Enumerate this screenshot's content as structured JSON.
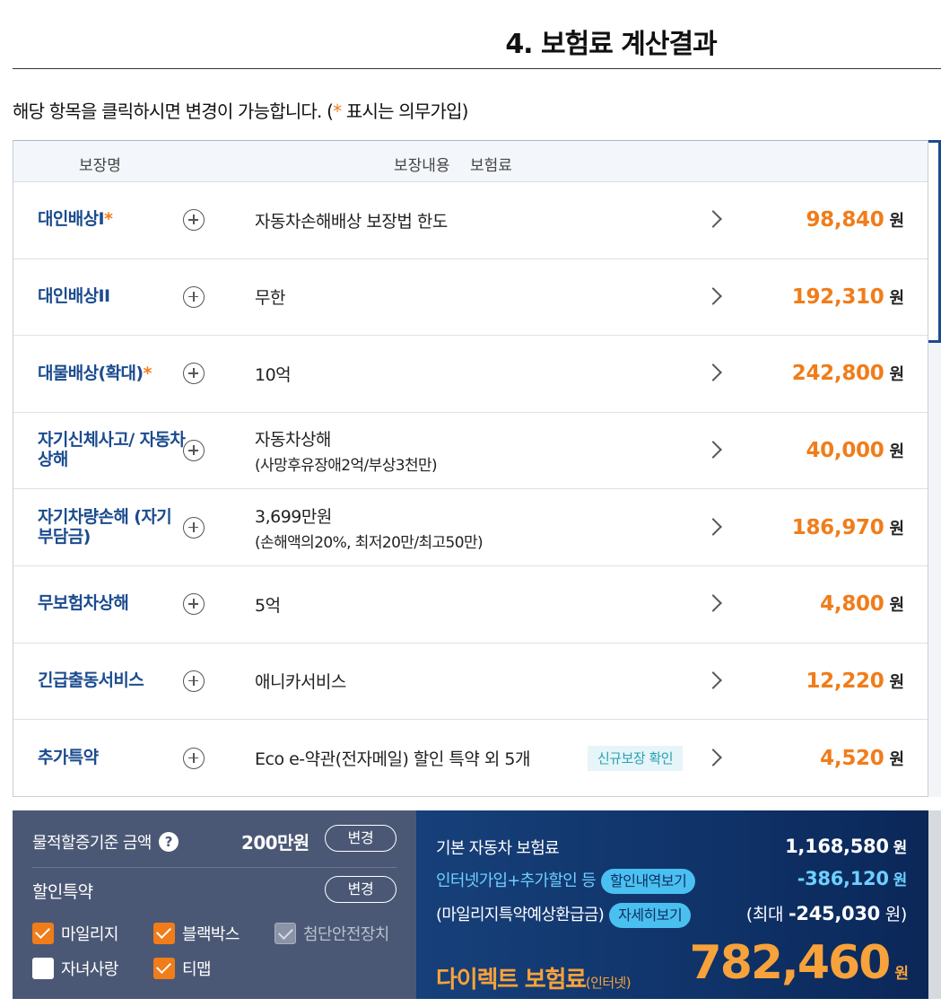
{
  "page": {
    "title": "4. 보험료 계산결과",
    "guide_prefix": "해당 항목을 클릭하시면 변경이 가능합니다. (",
    "guide_star": "*",
    "guide_suffix": " 표시는 의무가입)"
  },
  "table": {
    "headers": {
      "name": "보장명",
      "content": "보장내용",
      "premium": "보험료"
    },
    "unit": "원",
    "rows": [
      {
        "name": "대인배상I",
        "star": "*",
        "main": "자동차손해배상 보장법 한도",
        "sub": "",
        "tag": "",
        "amount": "98,840"
      },
      {
        "name": "대인배상II",
        "star": "",
        "main": "무한",
        "sub": "",
        "tag": "",
        "amount": "192,310"
      },
      {
        "name": "대물배상(확대)",
        "star": "*",
        "main": "10억",
        "sub": "",
        "tag": "",
        "amount": "242,800"
      },
      {
        "name": "자기신체사고/ 자동차상해",
        "star": "",
        "main": "자동차상해",
        "sub": "(사망후유장애2억/부상3천만)",
        "tag": "",
        "amount": "40,000"
      },
      {
        "name": "자기차량손해 (자기부담금)",
        "star": "",
        "main": "3,699만원",
        "sub": "(손해액의20%, 최저20만/최고50만)",
        "tag": "",
        "amount": "186,970"
      },
      {
        "name": "무보험차상해",
        "star": "",
        "main": "5억",
        "sub": "",
        "tag": "",
        "amount": "4,800"
      },
      {
        "name": "긴급출동서비스",
        "star": "",
        "main": "애니카서비스",
        "sub": "",
        "tag": "",
        "amount": "12,220"
      },
      {
        "name": "추가특약",
        "star": "",
        "main": "Eco e-약관(전자메일) 할인 특약 외 5개",
        "sub": "",
        "tag": "신규보장 확인",
        "amount": "4,520"
      }
    ]
  },
  "options": {
    "threshold_label": "물적할증기준 금액",
    "threshold_value": "200만원",
    "change_label": "변경",
    "discount_label": "할인특약",
    "checkboxes": [
      {
        "label": "마일리지",
        "state": "checked"
      },
      {
        "label": "블랙박스",
        "state": "checked"
      },
      {
        "label": "첨단안전장치",
        "state": "disabled"
      },
      {
        "label": "자녀사랑",
        "state": "unchecked"
      },
      {
        "label": "티맵",
        "state": "checked"
      }
    ]
  },
  "summary": {
    "base_label": "기본 자동차 보험료",
    "base_value": "1,168,580",
    "discount_label": "인터넷가입+추가할인 등",
    "discount_btn": "할인내역보기",
    "discount_value": "-386,120",
    "mileage_label": "(마일리지특약예상환급금)",
    "mileage_btn": "자세히보기",
    "mileage_prefix": "(최대",
    "mileage_value": "-245,030",
    "mileage_suffix": "원)",
    "total_label": "다이렉트 보험료",
    "total_sub": "(인터넷)",
    "total_value": "782,460",
    "unit": "원"
  },
  "colors": {
    "accent": "#f07d1a",
    "navy": "#1b4b8f",
    "panel_gray": "#4b5875",
    "panel_navy": "#0f3268",
    "sky": "#6ed0ff"
  }
}
